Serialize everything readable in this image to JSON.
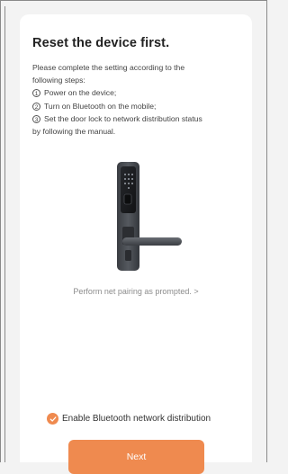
{
  "title": "Reset the device first.",
  "intro": {
    "line1": "Please complete the setting according to the",
    "line2": "following steps:",
    "steps": [
      {
        "num": "1",
        "text": "Power on the device;"
      },
      {
        "num": "2",
        "text": "Turn on Bluetooth on the mobile;"
      },
      {
        "num": "3",
        "text": "Set the door lock to network distribution status"
      }
    ],
    "step3_cont": "by following the manual."
  },
  "prompt_link": "Perform net pairing as prompted. >",
  "enable_option": {
    "label": "Enable Bluetooth network distribution",
    "checked": true
  },
  "next_button": "Next",
  "colors": {
    "accent": "#ef8a4f",
    "background": "#f3f3f3",
    "card": "#ffffff"
  },
  "icons": {
    "lock": "smart-door-lock-illustration",
    "check": "check-circle-icon"
  }
}
